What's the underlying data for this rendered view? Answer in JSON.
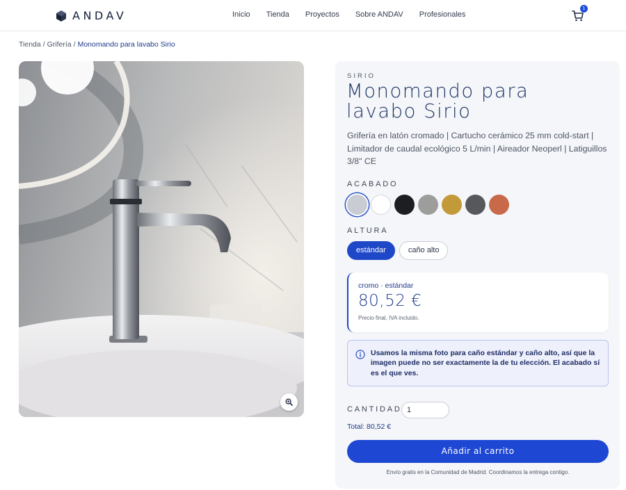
{
  "brand": {
    "name": "ANDAV"
  },
  "nav": {
    "items": [
      "Inicio",
      "Tienda",
      "Proyectos",
      "Sobre ANDAV",
      "Profesionales"
    ]
  },
  "cart": {
    "count": "1"
  },
  "breadcrumb": {
    "items": [
      "Tienda",
      "Grifería"
    ],
    "current": "Monomando para lavabo Sirio",
    "separator": "/"
  },
  "product": {
    "eyebrow": "SIRIO",
    "title": "Monomando para lavabo Sirio",
    "description": "Grifería en latón cromado | Cartucho cerámico 25 mm cold-start | Limitador de caudal ecológico 5 L/min | Aireador Neoperl | Latiguillos 3/8\" CE"
  },
  "finish": {
    "label": "ACABADO",
    "swatches": [
      {
        "name": "cromo",
        "color": "#c9ccd3",
        "selected": true
      },
      {
        "name": "blanco",
        "color": "#ffffff"
      },
      {
        "name": "negro",
        "color": "#1d1e21"
      },
      {
        "name": "gris",
        "color": "#9d9e9c"
      },
      {
        "name": "oro",
        "color": "#c39a3a"
      },
      {
        "name": "grafito",
        "color": "#56585c"
      },
      {
        "name": "cobre",
        "color": "#c8694a"
      }
    ]
  },
  "height": {
    "label": "ALTURA",
    "options": [
      "estándar",
      "caño alto"
    ],
    "selected": "estándar"
  },
  "price": {
    "variant": "cromo · estándar",
    "amount": "80,52 €",
    "note": "Precio final, IVA incluido."
  },
  "notice": {
    "text": "Usamos la misma foto para caño estándar y caño alto, así que la imagen puede no ser exactamente la de tu elección. El acabado sí es el que ves."
  },
  "quantity": {
    "label": "CANTIDAD",
    "value": "1"
  },
  "total": {
    "text": "Total: 80,52 €"
  },
  "cta": {
    "label": "Añadir al carrito"
  },
  "shipping": {
    "text": "Envío gratis en la Comunidad de Madrid. Coordinamos la entrega contigo."
  },
  "colors": {
    "accent": "#1e48c7",
    "brand_dark": "#16213a",
    "panel_bg": "#f5f6f9"
  },
  "icons": {
    "logo": "cube-icon",
    "cart": "cart-icon",
    "zoom": "zoom-in-icon",
    "info": "info-icon"
  }
}
